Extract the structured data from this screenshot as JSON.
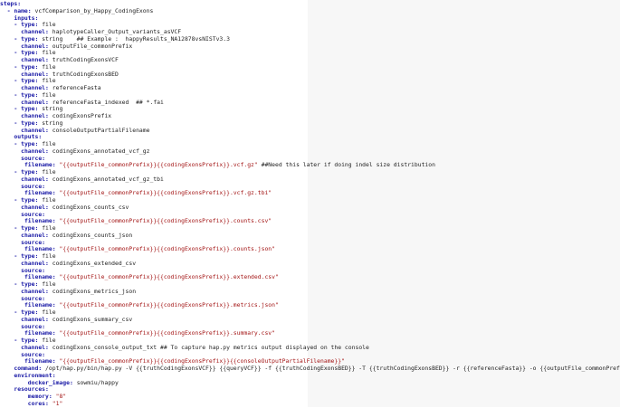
{
  "editor": {
    "lines": [
      {
        "indent": 0,
        "dash": false,
        "key": "steps:",
        "value": "",
        "comment": "",
        "is_string": false
      },
      {
        "indent": 1,
        "dash": true,
        "key": "name:",
        "value": "vcfComparison_by_Happy_CodingExons",
        "comment": "",
        "is_string": false
      },
      {
        "indent": 2,
        "dash": false,
        "key": "inputs:",
        "value": "",
        "comment": "",
        "is_string": false
      },
      {
        "indent": 2,
        "dash": true,
        "key": "type:",
        "value": "file",
        "comment": "",
        "is_string": false
      },
      {
        "indent": 3,
        "dash": false,
        "key": "channel:",
        "value": "haplotypeCaller_Output_variants_asVCF",
        "comment": "",
        "is_string": false
      },
      {
        "indent": 2,
        "dash": true,
        "key": "type:",
        "value": "string",
        "comment": "    ## Example :  happyResults_NA12878vsNISTv3.3",
        "is_string": false
      },
      {
        "indent": 3,
        "dash": false,
        "key": "channel:",
        "value": "outputFile_commonPrefix",
        "comment": "",
        "is_string": false
      },
      {
        "indent": 2,
        "dash": true,
        "key": "type:",
        "value": "file",
        "comment": "",
        "is_string": false
      },
      {
        "indent": 3,
        "dash": false,
        "key": "channel:",
        "value": "truthCodingExonsVCF",
        "comment": "",
        "is_string": false
      },
      {
        "indent": 2,
        "dash": true,
        "key": "type:",
        "value": "file",
        "comment": "",
        "is_string": false
      },
      {
        "indent": 3,
        "dash": false,
        "key": "channel:",
        "value": "truthCodingExonsBED",
        "comment": "",
        "is_string": false
      },
      {
        "indent": 2,
        "dash": true,
        "key": "type:",
        "value": "file",
        "comment": "",
        "is_string": false
      },
      {
        "indent": 3,
        "dash": false,
        "key": "channel:",
        "value": "referenceFasta",
        "comment": "",
        "is_string": false
      },
      {
        "indent": 2,
        "dash": true,
        "key": "type:",
        "value": "file",
        "comment": "",
        "is_string": false
      },
      {
        "indent": 3,
        "dash": false,
        "key": "channel:",
        "value": "referenceFasta_indexed",
        "comment": "  ## *.fai",
        "is_string": false
      },
      {
        "indent": 2,
        "dash": true,
        "key": "type:",
        "value": "string",
        "comment": "",
        "is_string": false
      },
      {
        "indent": 3,
        "dash": false,
        "key": "channel:",
        "value": "codingExonsPrefix",
        "comment": "",
        "is_string": false
      },
      {
        "indent": 2,
        "dash": true,
        "key": "type:",
        "value": "string",
        "comment": "",
        "is_string": false
      },
      {
        "indent": 3,
        "dash": false,
        "key": "channel:",
        "value": "consoleOutputPartialFilename",
        "comment": "",
        "is_string": false
      },
      {
        "indent": 2,
        "dash": false,
        "key": "outputs:",
        "value": "",
        "comment": "",
        "is_string": false
      },
      {
        "indent": 2,
        "dash": true,
        "key": "type:",
        "value": "file",
        "comment": "",
        "is_string": false
      },
      {
        "indent": 3,
        "dash": false,
        "key": "channel:",
        "value": "codingExons_annotated_vcf_gz",
        "comment": "",
        "is_string": false
      },
      {
        "indent": 3,
        "dash": false,
        "key": "source:",
        "value": "",
        "comment": "",
        "is_string": false
      },
      {
        "indent": 3.5,
        "dash": false,
        "key": "filename:",
        "value": "\"{{outputFile_commonPrefix}}{{codingExonsPrefix}}.vcf.gz\"",
        "comment": " ##Need this later if doing indel size distribution",
        "is_string": true
      },
      {
        "indent": 2,
        "dash": true,
        "key": "type:",
        "value": "file",
        "comment": "",
        "is_string": false
      },
      {
        "indent": 3,
        "dash": false,
        "key": "channel:",
        "value": "codingExons_annotated_vcf_gz_tbi",
        "comment": "",
        "is_string": false
      },
      {
        "indent": 3,
        "dash": false,
        "key": "source:",
        "value": "",
        "comment": "",
        "is_string": false
      },
      {
        "indent": 3.5,
        "dash": false,
        "key": "filename:",
        "value": "\"{{outputFile_commonPrefix}}{{codingExonsPrefix}}.vcf.gz.tbi\"",
        "comment": "",
        "is_string": true
      },
      {
        "indent": 2,
        "dash": true,
        "key": "type:",
        "value": "file",
        "comment": "",
        "is_string": false
      },
      {
        "indent": 3,
        "dash": false,
        "key": "channel:",
        "value": "codingExons_counts_csv",
        "comment": "",
        "is_string": false
      },
      {
        "indent": 3,
        "dash": false,
        "key": "source:",
        "value": "",
        "comment": "",
        "is_string": false
      },
      {
        "indent": 3.5,
        "dash": false,
        "key": "filename:",
        "value": "\"{{outputFile_commonPrefix}}{{codingExonsPrefix}}.counts.csv\"",
        "comment": "",
        "is_string": true
      },
      {
        "indent": 2,
        "dash": true,
        "key": "type:",
        "value": "file",
        "comment": "",
        "is_string": false
      },
      {
        "indent": 3,
        "dash": false,
        "key": "channel:",
        "value": "codingExons_counts_json",
        "comment": "",
        "is_string": false
      },
      {
        "indent": 3,
        "dash": false,
        "key": "source:",
        "value": "",
        "comment": "",
        "is_string": false
      },
      {
        "indent": 3.5,
        "dash": false,
        "key": "filename:",
        "value": "\"{{outputFile_commonPrefix}}{{codingExonsPrefix}}.counts.json\"",
        "comment": "",
        "is_string": true
      },
      {
        "indent": 2,
        "dash": true,
        "key": "type:",
        "value": "file",
        "comment": "",
        "is_string": false
      },
      {
        "indent": 3,
        "dash": false,
        "key": "channel:",
        "value": "codingExons_extended_csv",
        "comment": "",
        "is_string": false
      },
      {
        "indent": 3,
        "dash": false,
        "key": "source:",
        "value": "",
        "comment": "",
        "is_string": false
      },
      {
        "indent": 3.5,
        "dash": false,
        "key": "filename:",
        "value": "\"{{outputFile_commonPrefix}}{{codingExonsPrefix}}.extended.csv\"",
        "comment": "",
        "is_string": true
      },
      {
        "indent": 2,
        "dash": true,
        "key": "type:",
        "value": "file",
        "comment": "",
        "is_string": false
      },
      {
        "indent": 3,
        "dash": false,
        "key": "channel:",
        "value": "codingExons_metrics_json",
        "comment": "",
        "is_string": false
      },
      {
        "indent": 3,
        "dash": false,
        "key": "source:",
        "value": "",
        "comment": "",
        "is_string": false
      },
      {
        "indent": 3.5,
        "dash": false,
        "key": "filename:",
        "value": "\"{{outputFile_commonPrefix}}{{codingExonsPrefix}}.metrics.json\"",
        "comment": "",
        "is_string": true
      },
      {
        "indent": 2,
        "dash": true,
        "key": "type:",
        "value": "file",
        "comment": "",
        "is_string": false
      },
      {
        "indent": 3,
        "dash": false,
        "key": "channel:",
        "value": "codingExons_summary_csv",
        "comment": "",
        "is_string": false
      },
      {
        "indent": 3,
        "dash": false,
        "key": "source:",
        "value": "",
        "comment": "",
        "is_string": false
      },
      {
        "indent": 3.5,
        "dash": false,
        "key": "filename:",
        "value": "\"{{outputFile_commonPrefix}}{{codingExonsPrefix}}.summary.csv\"",
        "comment": "",
        "is_string": true
      },
      {
        "indent": 2,
        "dash": true,
        "key": "type:",
        "value": "file",
        "comment": "",
        "is_string": false
      },
      {
        "indent": 3,
        "dash": false,
        "key": "channel:",
        "value": "codingExons_console_output_txt",
        "comment": " ## To capture hap.py metrics output displayed on the console",
        "is_string": false
      },
      {
        "indent": 3,
        "dash": false,
        "key": "source:",
        "value": "",
        "comment": "",
        "is_string": false
      },
      {
        "indent": 3.5,
        "dash": false,
        "key": "filename:",
        "value": "\"{{outputFile_commonPrefix}}{{codingExonsPrefix}}{{consoleOutputPartialFilename}}\"",
        "comment": "",
        "is_string": true
      },
      {
        "indent": 2,
        "dash": false,
        "key": "command:",
        "value": "/opt/hap.py/bin/hap.py -V {{truthCodingExonsVCF}} {{queryVCF}} -f {{truthCodingExonsBED}} -T {{truthCodingExonsBED}} -r {{referenceFasta}} -o {{outputFile_commonPrefix}}",
        "comment": "",
        "is_string": false
      },
      {
        "indent": 2,
        "dash": false,
        "key": "environment:",
        "value": "",
        "comment": "",
        "is_string": false
      },
      {
        "indent": 4,
        "dash": false,
        "key": "docker_image:",
        "value": "sowmiu/happy",
        "comment": "",
        "is_string": false
      },
      {
        "indent": 2,
        "dash": false,
        "key": "resources:",
        "value": "",
        "comment": "",
        "is_string": false
      },
      {
        "indent": 4,
        "dash": false,
        "key": "memory:",
        "value": "\"8\"",
        "comment": "",
        "is_string": true
      },
      {
        "indent": 4,
        "dash": false,
        "key": "cores:",
        "value": "\"1\"",
        "comment": "",
        "is_string": true
      }
    ],
    "colors": {
      "key": "#1a1aa6",
      "string": "#a31515",
      "text": "#222222",
      "background": "#ffffff",
      "right_panel": "#f7f7f7"
    }
  }
}
